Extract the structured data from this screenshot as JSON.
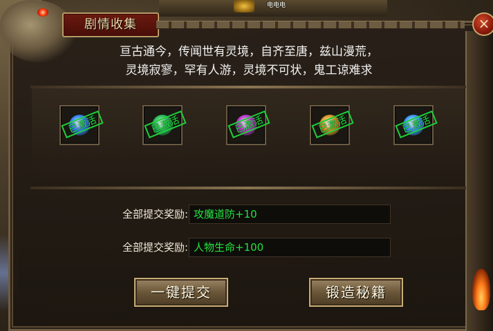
{
  "top_npc_name": "电电电",
  "dialog": {
    "title": "剧情收集",
    "close_symbol": "×",
    "poem_line1": "亘古通今，传闻世有灵境，自齐至唐，兹山漫荒，",
    "poem_line2": "灵境寂寥，罕有人游，灵境不可状，鬼工谅难求"
  },
  "items": [
    {
      "stamp": "已激活",
      "icon_color": "#3a88ff"
    },
    {
      "stamp": "已激活",
      "icon_color": "#30c060"
    },
    {
      "stamp": "已激活",
      "icon_color": "#c040d0"
    },
    {
      "stamp": "已激活",
      "icon_color": "#e0a030"
    },
    {
      "stamp": "已激活",
      "icon_color": "#40a0ff"
    }
  ],
  "rewards": [
    {
      "label": "全部提交奖励:",
      "value": "攻魔道防+10"
    },
    {
      "label": "全部提交奖励:",
      "value": "人物生命+100"
    }
  ],
  "buttons": {
    "submit_all": "一键提交",
    "forge_secret": "锻造秘籍"
  },
  "colors": {
    "reward_text": "#23e23f",
    "stamp": "#1fe040",
    "title_plate": "#6a1a10"
  }
}
